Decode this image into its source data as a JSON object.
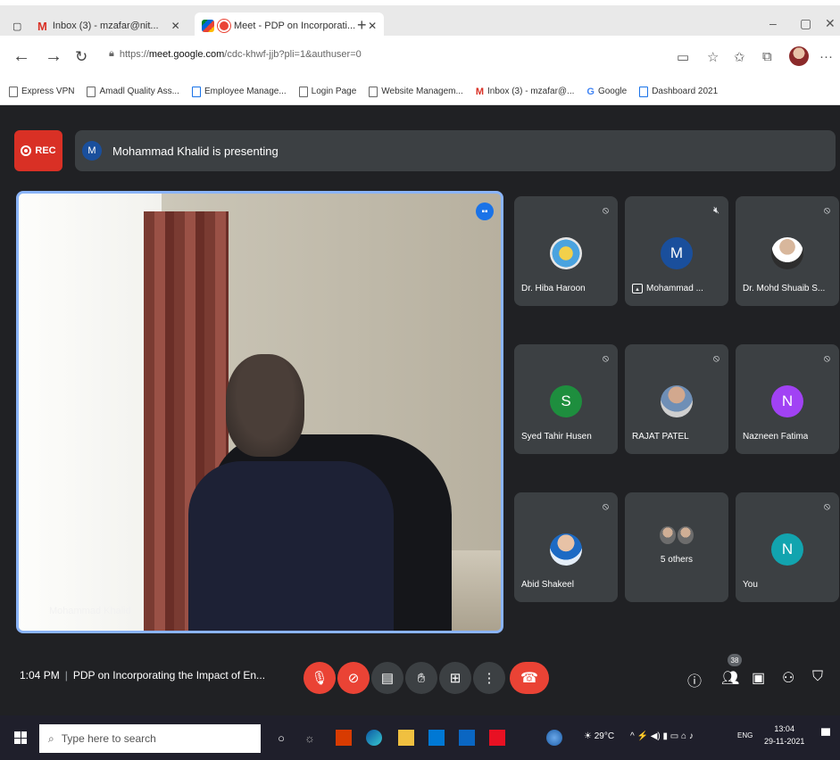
{
  "browser": {
    "tabs": [
      {
        "label": "Inbox (3) - mzafar@nit...",
        "icon": "gmail-icon"
      },
      {
        "label": "Meet - PDP on Incorporati...",
        "icon": "meet-icon"
      }
    ],
    "url_prefix": "https://",
    "url_domain": "meet.google.com",
    "url_path": "/cdc-khwf-jjb?pli=1&authuser=0",
    "bookmarks": [
      {
        "label": "Express VPN",
        "icon": "page"
      },
      {
        "label": "Amadl Quality Ass...",
        "icon": "page"
      },
      {
        "label": "Employee Manage...",
        "icon": "grid"
      },
      {
        "label": "Login Page",
        "icon": "page"
      },
      {
        "label": "Website Managem...",
        "icon": "page"
      },
      {
        "label": "Inbox (3) - mzafar@...",
        "icon": "m"
      },
      {
        "label": "Google",
        "icon": "g"
      },
      {
        "label": "Dashboard 2021",
        "icon": "grid"
      }
    ]
  },
  "meet": {
    "rec_label": "REC",
    "presenter_initial": "M",
    "presenting_text": "Mohammad Khalid is presenting",
    "main_video_name": "Mohammad Khalid",
    "participants": [
      {
        "name": "Dr. Hiba Haroon",
        "avatar": "photo1",
        "initial": "",
        "color": ""
      },
      {
        "name": "Mohammad ...",
        "avatar": "initial",
        "initial": "M",
        "color": "#1a4f9c",
        "presenting": true
      },
      {
        "name": "Dr. Mohd Shuaib S...",
        "avatar": "photo2",
        "initial": "",
        "color": ""
      },
      {
        "name": "Syed Tahir Husen",
        "avatar": "initial",
        "initial": "S",
        "color": "#1e8e3e"
      },
      {
        "name": "RAJAT PATEL",
        "avatar": "photo3",
        "initial": "",
        "color": ""
      },
      {
        "name": "Nazneen Fatima",
        "avatar": "initial",
        "initial": "N",
        "color": "#a142f4"
      },
      {
        "name": "Abid Shakeel",
        "avatar": "photo4",
        "initial": "",
        "color": ""
      },
      {
        "name": "5 others",
        "avatar": "others",
        "initial": "",
        "color": ""
      },
      {
        "name": "You",
        "avatar": "initial",
        "initial": "N",
        "color": "#12a4af"
      }
    ],
    "time": "1:04 PM",
    "meeting_title": "PDP on Incorporating the Impact of En...",
    "participant_count": "38"
  },
  "taskbar": {
    "search_placeholder": "Type here to search",
    "weather": "29°C",
    "lang": "ENG",
    "time": "13:04",
    "date": "29-11-2021"
  }
}
